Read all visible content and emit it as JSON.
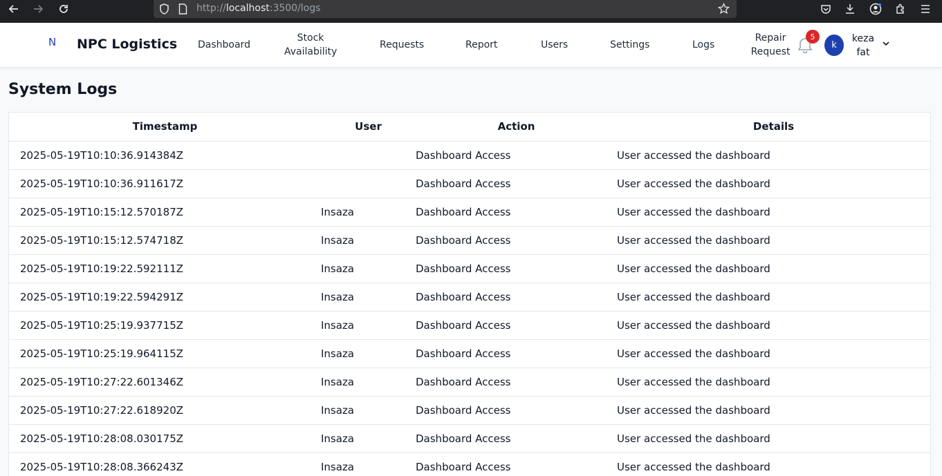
{
  "browser": {
    "url_scheme": "http://",
    "url_host": "localhost",
    "url_rest": ":3500/logs"
  },
  "navbar": {
    "logo_letter": "N",
    "brand": "NPC Logistics",
    "links": [
      {
        "line1": "Dashboard",
        "line2": ""
      },
      {
        "line1": "Stock",
        "line2": "Availability"
      },
      {
        "line1": "Requests",
        "line2": ""
      },
      {
        "line1": "Report",
        "line2": ""
      },
      {
        "line1": "Users",
        "line2": ""
      },
      {
        "line1": "Settings",
        "line2": ""
      },
      {
        "line1": "Logs",
        "line2": ""
      },
      {
        "line1": "Repair",
        "line2": "Request"
      }
    ],
    "notification_count": "5",
    "avatar_letter": "k",
    "user_first": "keza",
    "user_last": "fat"
  },
  "page": {
    "title": "System Logs"
  },
  "table": {
    "headers": [
      "Timestamp",
      "User",
      "Action",
      "Details"
    ],
    "rows": [
      {
        "timestamp": "2025-05-19T10:10:36.914384Z",
        "user": "",
        "action": "Dashboard Access",
        "details": "User accessed the dashboard"
      },
      {
        "timestamp": "2025-05-19T10:10:36.911617Z",
        "user": "",
        "action": "Dashboard Access",
        "details": "User accessed the dashboard"
      },
      {
        "timestamp": "2025-05-19T10:15:12.570187Z",
        "user": "Insaza",
        "action": "Dashboard Access",
        "details": "User accessed the dashboard"
      },
      {
        "timestamp": "2025-05-19T10:15:12.574718Z",
        "user": "Insaza",
        "action": "Dashboard Access",
        "details": "User accessed the dashboard"
      },
      {
        "timestamp": "2025-05-19T10:19:22.592111Z",
        "user": "Insaza",
        "action": "Dashboard Access",
        "details": "User accessed the dashboard"
      },
      {
        "timestamp": "2025-05-19T10:19:22.594291Z",
        "user": "Insaza",
        "action": "Dashboard Access",
        "details": "User accessed the dashboard"
      },
      {
        "timestamp": "2025-05-19T10:25:19.937715Z",
        "user": "Insaza",
        "action": "Dashboard Access",
        "details": "User accessed the dashboard"
      },
      {
        "timestamp": "2025-05-19T10:25:19.964115Z",
        "user": "Insaza",
        "action": "Dashboard Access",
        "details": "User accessed the dashboard"
      },
      {
        "timestamp": "2025-05-19T10:27:22.601346Z",
        "user": "Insaza",
        "action": "Dashboard Access",
        "details": "User accessed the dashboard"
      },
      {
        "timestamp": "2025-05-19T10:27:22.618920Z",
        "user": "Insaza",
        "action": "Dashboard Access",
        "details": "User accessed the dashboard"
      },
      {
        "timestamp": "2025-05-19T10:28:08.030175Z",
        "user": "Insaza",
        "action": "Dashboard Access",
        "details": "User accessed the dashboard"
      },
      {
        "timestamp": "2025-05-19T10:28:08.366243Z",
        "user": "Insaza",
        "action": "Dashboard Access",
        "details": "User accessed the dashboard"
      }
    ]
  }
}
